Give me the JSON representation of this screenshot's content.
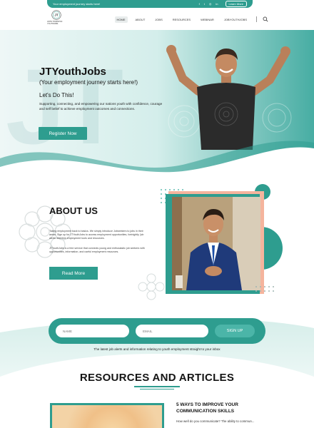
{
  "topbar": {
    "tagline": "Your employment journey starts here!",
    "social": [
      "f",
      "t",
      "◎",
      "in"
    ],
    "learn_more": "Learn More"
  },
  "header": {
    "logo_text": "JOHN THURSTON YOUTHJOBS",
    "nav": [
      {
        "label": "HOME",
        "active": true
      },
      {
        "label": "ABOUT",
        "active": false
      },
      {
        "label": "JOBS",
        "active": false
      },
      {
        "label": "RESOURCES",
        "active": false
      },
      {
        "label": "WEBINAR",
        "active": false
      },
      {
        "label": "JOBYOUTHJOBS",
        "active": false
      }
    ]
  },
  "hero": {
    "watermark": "JT",
    "title": "JTYouthJobs",
    "subtitle": "(Your employment journey starts here!)",
    "tagline": "Let's Do This!",
    "description": "Supporting, connecting, and empowering our nations youth with confidence, courage and self belief to achieve employment outcomes and connections.",
    "button": "Register Now"
  },
  "about": {
    "title": "ABOUT US",
    "p1": "Taking employment back to basics. We simply introduce Jobseekers to jobs in their areas. Sign up for JTYouthJobs to access employment opportunities, fortnightly 'job alerts' and free employment tools and resources.",
    "p2": "JTYouthJobs is a free service that connects young and enthusiastic job seekers with opportunities, information, and useful employment resources.",
    "button": "Read More"
  },
  "signup": {
    "name_placeholder": "NAME",
    "email_placeholder": "EMAIL",
    "button": "SIGN UP",
    "note": "The latest job alerts and information relating to youth employment straight to your inbox"
  },
  "resources": {
    "title": "RESOURCES AND ARTICLES",
    "article": {
      "title": "5 WAYS TO IMPROVE YOUR COMMUNICATION SKILLS",
      "excerpt": "How well do you communicate? The ability to commun..."
    }
  },
  "colors": {
    "teal": "#2e9d8f",
    "peach": "#f5b49d",
    "dark_text": "#141414"
  }
}
